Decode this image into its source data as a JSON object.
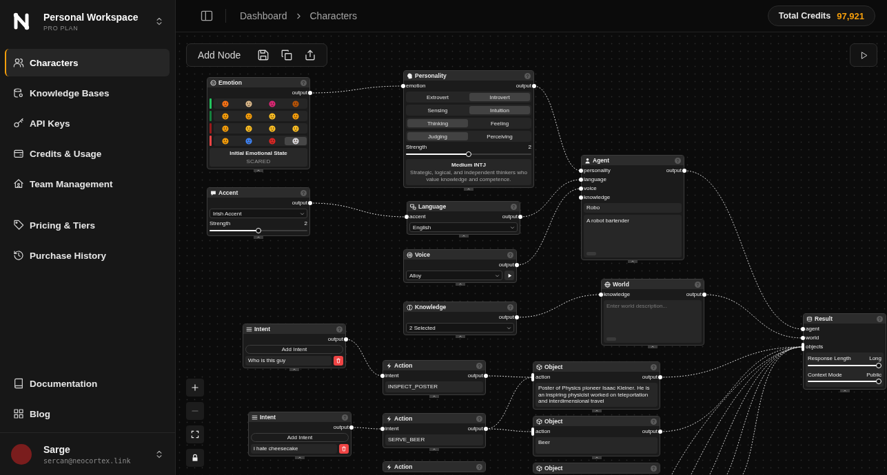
{
  "sidebar": {
    "workspace": {
      "name": "Personal Workspace",
      "plan": "PRO PLAN"
    },
    "nav_sections": [
      {
        "items": [
          {
            "label": "Characters",
            "selected": true
          },
          {
            "label": "Knowledge Bases",
            "selected": false
          },
          {
            "label": "API Keys",
            "selected": false
          },
          {
            "label": "Credits & Usage",
            "selected": false
          },
          {
            "label": "Team Management",
            "selected": false
          }
        ]
      },
      {
        "items": [
          {
            "label": "Pricing & Tiers",
            "selected": false
          },
          {
            "label": "Purchase History",
            "selected": false
          }
        ]
      },
      {
        "items": [
          {
            "label": "Documentation",
            "selected": false
          },
          {
            "label": "Blog",
            "selected": false
          }
        ]
      }
    ],
    "user": {
      "name": "Sarge",
      "email": "sercan@neocortex.link"
    }
  },
  "header": {
    "breadcrumb": [
      "Dashboard",
      "Characters"
    ],
    "credits": {
      "label": "Total Credits",
      "value": "97,921"
    }
  },
  "canvas": {
    "toolbar": {
      "add_node": "Add Node"
    },
    "nodes": [
      {
        "kind": "emotion",
        "title": "Emotion",
        "outputs": [
          "output"
        ],
        "rows": [
          {
            "color": "#22c55e",
            "cells": [
              {
                "selected": false
              },
              {
                "selected": false
              },
              {
                "selected": false
              },
              {
                "selected": false
              }
            ]
          },
          {
            "color": "#15803d",
            "cells": [
              {
                "selected": false
              },
              {
                "selected": false
              },
              {
                "selected": false
              },
              {
                "selected": false
              }
            ]
          },
          {
            "color": "#991b1b",
            "cells": [
              {
                "selected": false
              },
              {
                "selected": false
              },
              {
                "selected": false
              },
              {
                "selected": false
              }
            ]
          },
          {
            "color": "#ef4444",
            "cells": [
              {
                "selected": false
              },
              {
                "selected": false
              },
              {
                "selected": false
              },
              {
                "selected": true
              }
            ]
          }
        ],
        "state_label": "Initial Emotional State",
        "state_value": "SCARED"
      },
      {
        "kind": "accent",
        "title": "Accent",
        "outputs": [
          "output"
        ],
        "select": "Irish Accent",
        "slider": {
          "label": "Strength",
          "reading": "2",
          "level": 0.5
        }
      },
      {
        "kind": "intent",
        "title": "Intent",
        "outputs": [
          "output"
        ],
        "add_button": "Add Intent",
        "entries": [
          "Who is this guy"
        ]
      },
      {
        "kind": "intent",
        "title": "Intent",
        "outputs": [
          "output"
        ],
        "add_button": "Add Intent",
        "entries": [
          "i hate cheesecake"
        ]
      },
      {
        "kind": "personality",
        "title": "Personality",
        "inputs": [
          {
            "label": "emotion",
            "kind": "dot"
          }
        ],
        "outputs": [
          "output"
        ],
        "toggles": [
          {
            "options": [
              {
                "label": "Extrovert",
                "selected": false
              },
              {
                "label": "Introvert",
                "selected": true
              }
            ]
          },
          {
            "options": [
              {
                "label": "Sensing",
                "selected": false
              },
              {
                "label": "Intuition",
                "selected": true
              }
            ]
          },
          {
            "options": [
              {
                "label": "Thinking",
                "selected": true
              },
              {
                "label": "Feeling",
                "selected": false
              }
            ]
          },
          {
            "options": [
              {
                "label": "Judging",
                "selected": true
              },
              {
                "label": "Perceiving",
                "selected": false
              }
            ]
          }
        ],
        "slider": {
          "label": "Strength",
          "reading": "2",
          "level": 0.5
        },
        "summary": {
          "title": "Medium INTJ",
          "text": "Strategic, logical, and independent thinkers who value knowledge and competence."
        }
      },
      {
        "kind": "language",
        "title": "Language",
        "inputs": [
          {
            "label": "accent",
            "kind": "dot"
          }
        ],
        "outputs": [
          "output"
        ],
        "select": "English"
      },
      {
        "kind": "voice",
        "title": "Voice",
        "outputs": [
          "output"
        ],
        "select": "Alloy"
      },
      {
        "kind": "knowledge",
        "title": "Knowledge",
        "outputs": [
          "output"
        ],
        "select": "2 Selected"
      },
      {
        "kind": "action",
        "title": "Action",
        "inputs": [
          {
            "label": "intent",
            "kind": "dot"
          }
        ],
        "outputs": [
          "output"
        ],
        "value": "INSPECT_POSTER"
      },
      {
        "kind": "action",
        "title": "Action",
        "inputs": [
          {
            "label": "intent",
            "kind": "dot"
          }
        ],
        "outputs": [
          "output"
        ],
        "value": "SERVE_BEER"
      },
      {
        "kind": "action",
        "title": "Action"
      },
      {
        "kind": "agent",
        "title": "Agent",
        "inputs": [
          {
            "label": "personality",
            "kind": "dot"
          },
          {
            "label": "language",
            "kind": "dot"
          },
          {
            "label": "voice",
            "kind": "dot"
          },
          {
            "label": "knowledge",
            "kind": "dot"
          }
        ],
        "outputs": [
          "output"
        ],
        "name": "Robo",
        "description": "A robot bartender"
      },
      {
        "kind": "world",
        "title": "World",
        "inputs": [
          {
            "label": "knowledge",
            "kind": "dot"
          }
        ],
        "outputs": [
          "output"
        ],
        "placeholder": "Enter world description..."
      },
      {
        "kind": "object",
        "title": "Object",
        "inputs": [
          {
            "label": "action",
            "kind": "bar"
          }
        ],
        "outputs": [
          "output"
        ],
        "text": "Poster of Physics pioneer Isaac Kleiner. He is an inspiring physicist worked on teleportation and interdimensional travel"
      },
      {
        "kind": "object",
        "title": "Object",
        "inputs": [
          {
            "label": "action",
            "kind": "bar"
          }
        ],
        "outputs": [
          "output"
        ],
        "text": "Beer"
      },
      {
        "kind": "object",
        "title": "Object"
      },
      {
        "kind": "result",
        "title": "Result",
        "inputs": [
          {
            "label": "agent",
            "kind": "dot"
          },
          {
            "label": "world",
            "kind": "dot"
          },
          {
            "label": "objects",
            "kind": "bar"
          }
        ],
        "sliders": [
          {
            "label": "Response Length",
            "reading": "Long",
            "level": 1
          },
          {
            "label": "Context Mode",
            "reading": "Public",
            "level": 1
          }
        ]
      }
    ]
  }
}
